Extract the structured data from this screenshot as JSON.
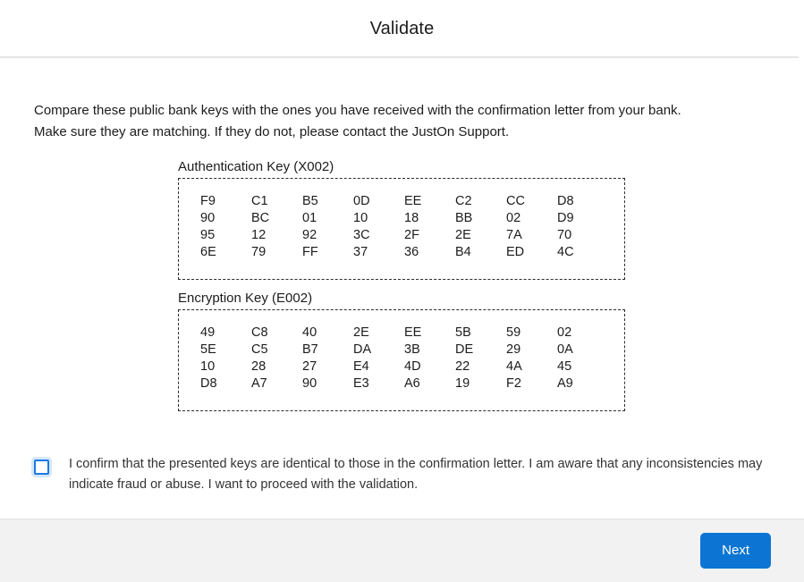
{
  "header": {
    "title": "Validate"
  },
  "intro": {
    "line1": "Compare these public bank keys with the ones you have received with the confirmation letter from your bank.",
    "line2": "Make sure they are matching. If they do not, please contact the JustOn Support."
  },
  "keys": [
    {
      "label": "Authentication Key (X002)",
      "rows": [
        [
          "F9",
          "C1",
          "B5",
          "0D",
          "EE",
          "C2",
          "CC",
          "D8"
        ],
        [
          "90",
          "BC",
          "01",
          "10",
          "18",
          "BB",
          "02",
          "D9"
        ],
        [
          "95",
          "12",
          "92",
          "3C",
          "2F",
          "2E",
          "7A",
          "70"
        ],
        [
          "6E",
          "79",
          "FF",
          "37",
          "36",
          "B4",
          "ED",
          "4C"
        ]
      ]
    },
    {
      "label": "Encryption Key (E002)",
      "rows": [
        [
          "49",
          "C8",
          "40",
          "2E",
          "EE",
          "5B",
          "59",
          "02"
        ],
        [
          "5E",
          "C5",
          "B7",
          "DA",
          "3B",
          "DE",
          "29",
          "0A"
        ],
        [
          "10",
          "28",
          "27",
          "E4",
          "4D",
          "22",
          "4A",
          "45"
        ],
        [
          "D8",
          "A7",
          "90",
          "E3",
          "A6",
          "19",
          "F2",
          "A9"
        ]
      ]
    }
  ],
  "confirm": {
    "checked": false,
    "text": "I confirm that the presented keys are identical to those in the confirmation letter. I am aware that any inconsistencies may indicate fraud or abuse. I want to proceed with the validation."
  },
  "footer": {
    "next_label": "Next"
  },
  "colors": {
    "accent_blue": "#0c75d3",
    "checkbox_blue": "#1b7ae4",
    "footer_bg": "#f2f2f2",
    "divider": "#e5e5e5"
  }
}
